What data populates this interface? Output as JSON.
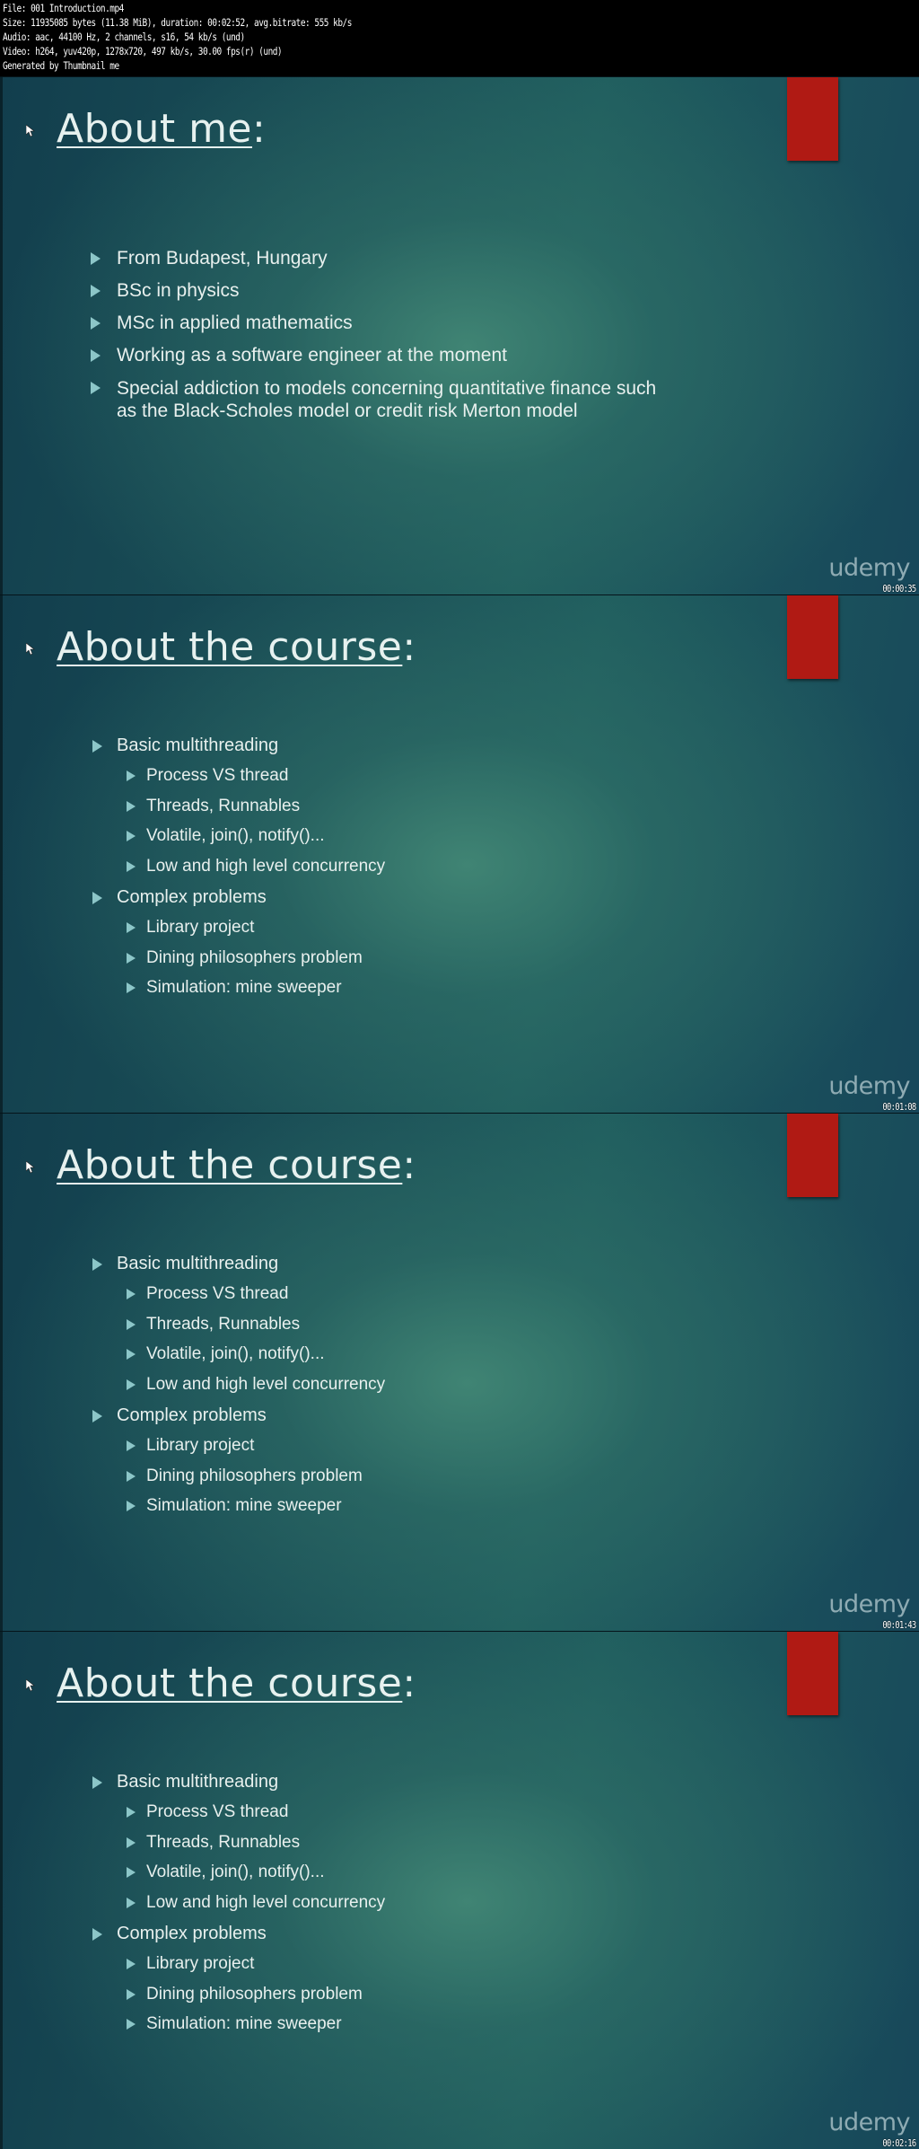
{
  "header": {
    "lines": [
      "File: 001 Introduction.mp4",
      "Size: 11935085 bytes (11.38 MiB), duration: 00:02:52, avg.bitrate: 555 kb/s",
      "Audio: aac, 44100 Hz, 2 channels, s16, 54 kb/s (und)",
      "Video: h264, yuv420p, 1278x720, 497 kb/s, 30.00 fps(r) (und)",
      "Generated by Thumbnail me"
    ]
  },
  "colors": {
    "accent_red": "#b01a14",
    "bullet_arrow": "#8cc6c8",
    "slide_bg_dark": "#123e4d",
    "slide_bg_light": "#3f7e72"
  },
  "logo": "udemy",
  "frames": [
    {
      "timestamp": "00:00:35",
      "title": "About me",
      "title_suffix": ":",
      "bullets": [
        "From Budapest, Hungary",
        "BSc in physics",
        "MSc in applied mathematics",
        "Working as a software engineer at the moment",
        "Special addiction to models concerning quantitative finance such",
        "as the Black-Scholes model or credit risk Merton model"
      ]
    },
    {
      "timestamp": "00:01:08",
      "title": "About the course",
      "title_suffix": ":",
      "sections": [
        {
          "label": "Basic multithreading",
          "items": [
            "Process VS thread",
            "Threads, Runnables",
            "Volatile, join(), notify()...",
            "Low and high level concurrency"
          ]
        },
        {
          "label": "Complex problems",
          "items": [
            "Library project",
            "Dining philosophers problem",
            "Simulation: mine sweeper"
          ]
        }
      ]
    },
    {
      "timestamp": "00:01:43",
      "title": "About the course",
      "title_suffix": ":",
      "sections": [
        {
          "label": "Basic multithreading",
          "items": [
            "Process VS thread",
            "Threads, Runnables",
            "Volatile, join(), notify()...",
            "Low and high level concurrency"
          ]
        },
        {
          "label": "Complex problems",
          "items": [
            "Library project",
            "Dining philosophers problem",
            "Simulation: mine sweeper"
          ]
        }
      ]
    },
    {
      "timestamp": "00:02:16",
      "title": "About the course",
      "title_suffix": ":",
      "sections": [
        {
          "label": "Basic multithreading",
          "items": [
            "Process VS thread",
            "Threads, Runnables",
            "Volatile, join(), notify()...",
            "Low and high level concurrency"
          ]
        },
        {
          "label": "Complex problems",
          "items": [
            "Library project",
            "Dining philosophers problem",
            "Simulation: mine sweeper"
          ]
        }
      ]
    }
  ]
}
